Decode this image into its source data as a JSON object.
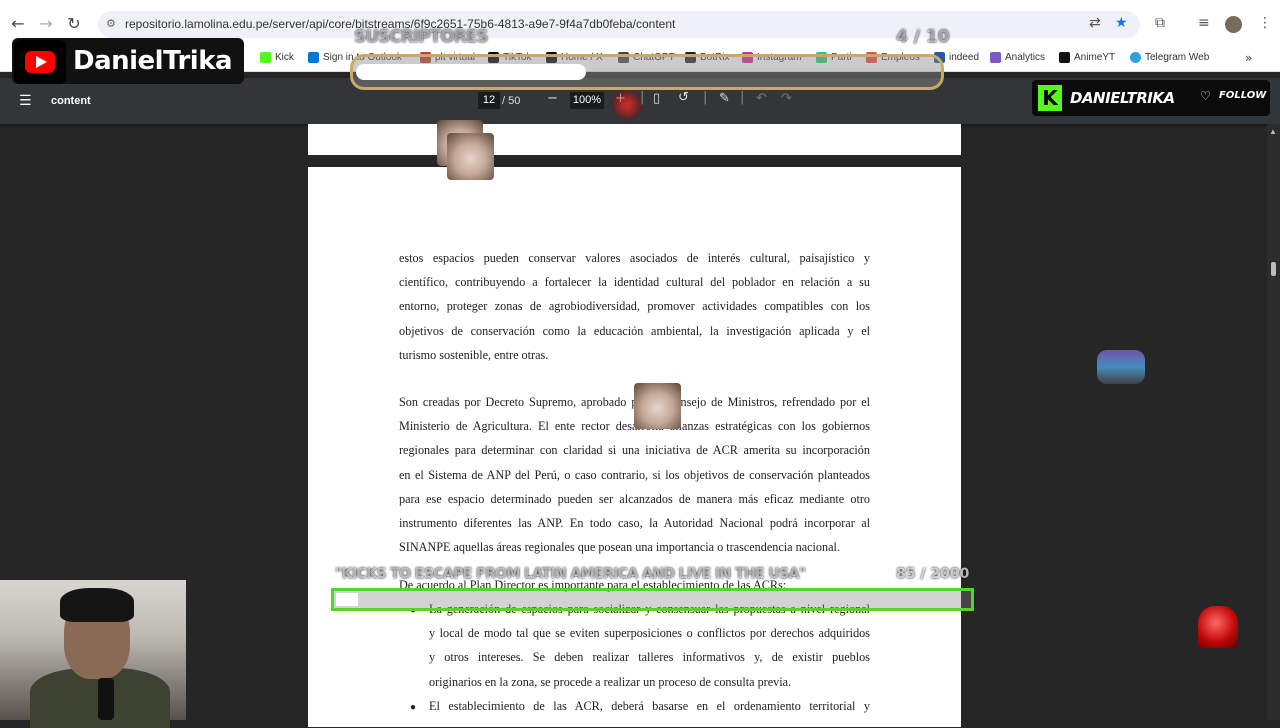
{
  "browser": {
    "url": "repositorio.lamolina.edu.pe/server/api/core/bitstreams/6f9c2651-75b6-4813-a9e7-9f4a7db0feba/content",
    "bookmarks": [
      {
        "label": "Kick",
        "color": "#53fc18"
      },
      {
        "label": "Sign in to Outlook",
        "color": "#0078d4"
      },
      {
        "label": "plt virtual",
        "color": "#c0392b"
      },
      {
        "label": "TikTok",
        "color": "#000000"
      },
      {
        "label": "Home / X",
        "color": "#000000"
      },
      {
        "label": "ChatGPT",
        "color": "#444444"
      },
      {
        "label": "BotRix",
        "color": "#222222"
      },
      {
        "label": "Instagram",
        "color": "#d6249f"
      },
      {
        "label": "Parti",
        "color": "#2ecc71"
      },
      {
        "label": "Empleos",
        "color": "#e74c3c"
      },
      {
        "label": "indeed",
        "color": "#2557a7"
      },
      {
        "label": "Analytics",
        "color": "#7e57c2"
      },
      {
        "label": "AnimeYT",
        "color": "#111111"
      },
      {
        "label": "Telegram Web",
        "color": "#2aa3df"
      }
    ]
  },
  "pdf": {
    "title": "content",
    "current_page": "12",
    "total_pages": "/ 50",
    "zoom": "100%",
    "paragraphs": {
      "p1": [
        "estos espacios pueden conservar valores asociados de interés cultural, paisajístico y",
        "científico, contribuyendo a fortalecer la identidad cultural del poblador en relación a su",
        "entorno, proteger zonas de agrobiodiversidad, promover actividades compatibles con los",
        "objetivos de conservación como la educación ambiental, la investigación aplicada y el",
        "turismo sostenible, entre otras."
      ],
      "p2": [
        "Son creadas por Decreto Supremo, aprobado por el Consejo de Ministros, refrendado por el",
        "Ministerio de Agricultura. El ente rector desarrolla alianzas estratégicas con los gobiernos",
        "regionales para determinar con claridad si una iniciativa de ACR amerita su incorporación",
        "en el Sistema de ANP del Perú, o caso contrario, si los objetivos de conservación planteados",
        "para ese espacio determinado pueden ser alcanzados de manera más eficaz mediante otro",
        "instrumento diferentes las ANP. En todo caso, la Autoridad Nacional podrá incorporar al",
        "SINANPE aquellas áreas regionales que posean una importancia o trascendencia nacional."
      ],
      "p3": "De acuerdo al Plan Director es importante para el establecimiento de las ACRs:",
      "bullet1": [
        "La generación de espacios para socializar y consensuar las propuestas a nivel regional",
        "y local de modo tal que se eviten superposiciones o conflictos por derechos adquiridos",
        "y otros intereses. Se deben realizar talleres informativos y, de existir pueblos",
        "originarios en la zona, se procede a realizar un proceso de consulta previa."
      ],
      "bullet2": "El establecimiento de las ACR, deberá basarse en el ordenamiento territorial y"
    }
  },
  "overlay": {
    "youtube_name": "DanielTrika",
    "sub_goal_label": "SUSCRIPTORES",
    "sub_goal_count": "4 / 10",
    "kick_name": "DANIELTRIKA",
    "kick_follow": "FOLLOW",
    "goal2_label": "\"KICKS TO ESCAPE FROM LATIN AMERICA AND LIVE IN THE USA\"",
    "goal2_count": "85 / 2000"
  }
}
